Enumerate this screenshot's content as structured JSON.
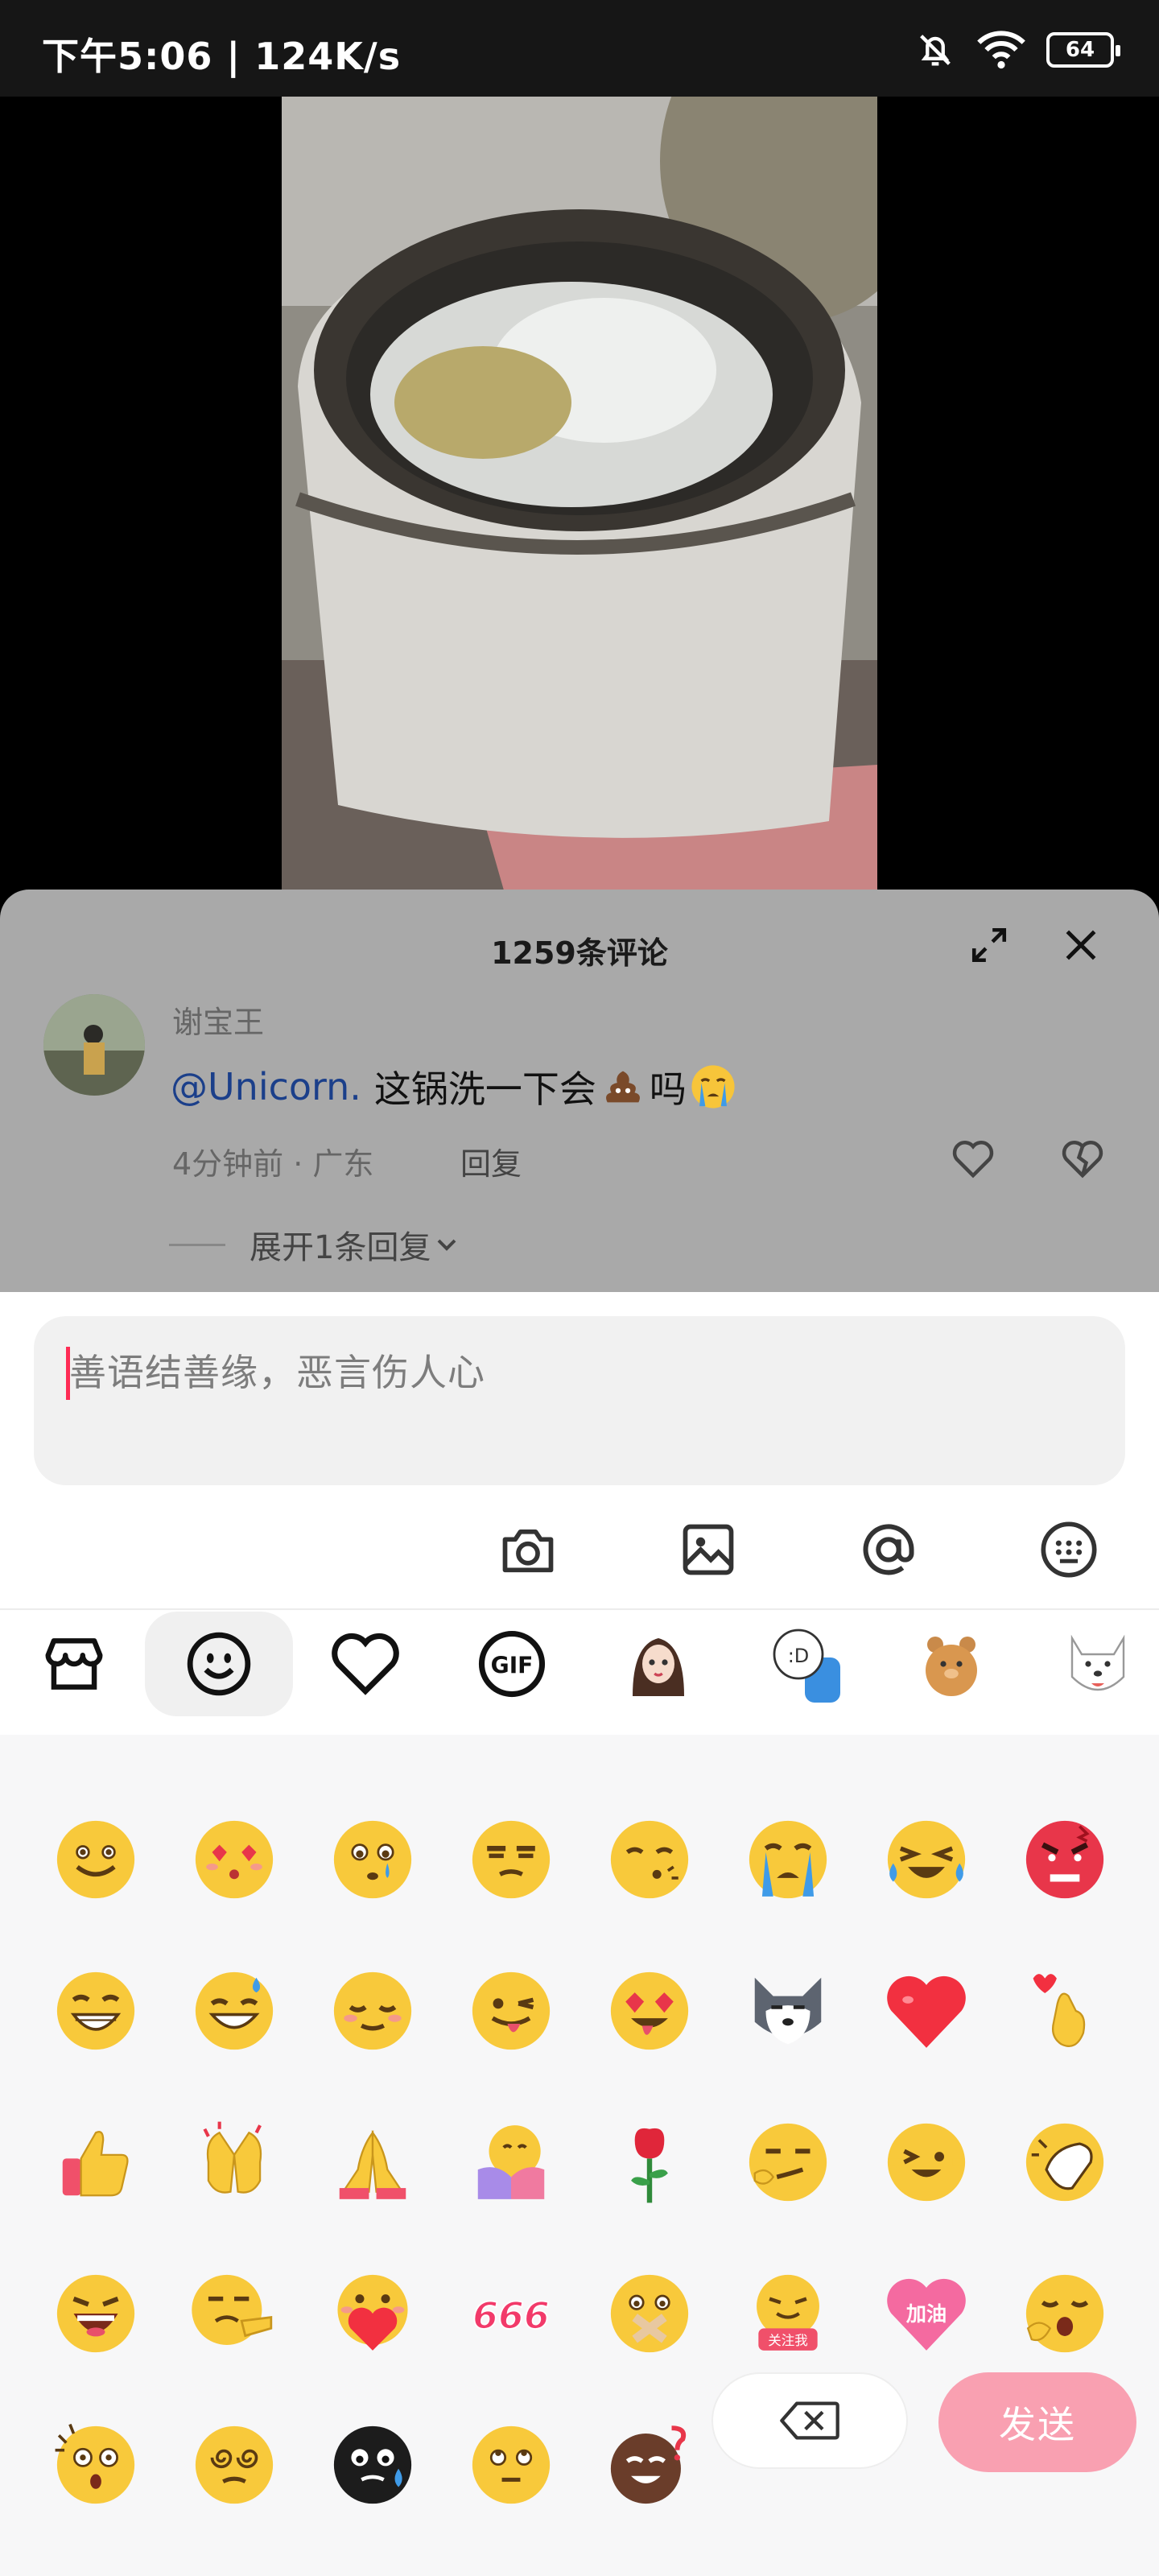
{
  "status": {
    "time_speed": "下午5:06 | 124K/s",
    "battery": "64"
  },
  "comments": {
    "count_title": "1259条评论",
    "item": {
      "username": "谢宝王",
      "mention": "@Unicorn.",
      "text_a": "这锅洗一下会",
      "text_b": "吗",
      "meta": "4分钟前 · 广东",
      "reply_label": "回复",
      "expand_label": "展开1条回复"
    }
  },
  "input": {
    "placeholder": "善语结善缘，恶言伤人心"
  },
  "tools": [
    "camera-icon",
    "image-icon",
    "at-icon",
    "keyboard-icon"
  ],
  "tabs": [
    "store-icon",
    "smiley-icon",
    "heart-icon",
    "gif-icon",
    "avatar-sticker",
    "meme-sticker",
    "bear-sticker",
    "dog-sticker"
  ],
  "emoji_grid": [
    [
      "smile",
      "heart-eyes-kiss",
      "tearful",
      "annoyed",
      "whistle",
      "crying",
      "laughing-tears",
      "angry"
    ],
    [
      "grin",
      "sweat-smile",
      "shy",
      "tongue-wink",
      "drool-love",
      "husky",
      "red-heart",
      "finger-heart"
    ],
    [
      "thumbs-up",
      "clapping",
      "pray",
      "hug",
      "rose",
      "smirk",
      "wink-tongue",
      "facepalm"
    ],
    [
      "laugh",
      "point",
      "heart-hold",
      "666",
      "zipped",
      "follow-me",
      "jiayou",
      "yawn"
    ],
    [
      "shock",
      "dizzy",
      "black-sweat",
      "eye-roll",
      "brown-question"
    ]
  ],
  "sticker_labels": {
    "n666": "666",
    "follow": "关注我",
    "jiayou": "加油"
  },
  "actions": {
    "send_label": "发送"
  },
  "colors": {
    "accent": "#fe2c55",
    "send_bg": "#f9a0b1",
    "mention": "#1b3f8a"
  }
}
